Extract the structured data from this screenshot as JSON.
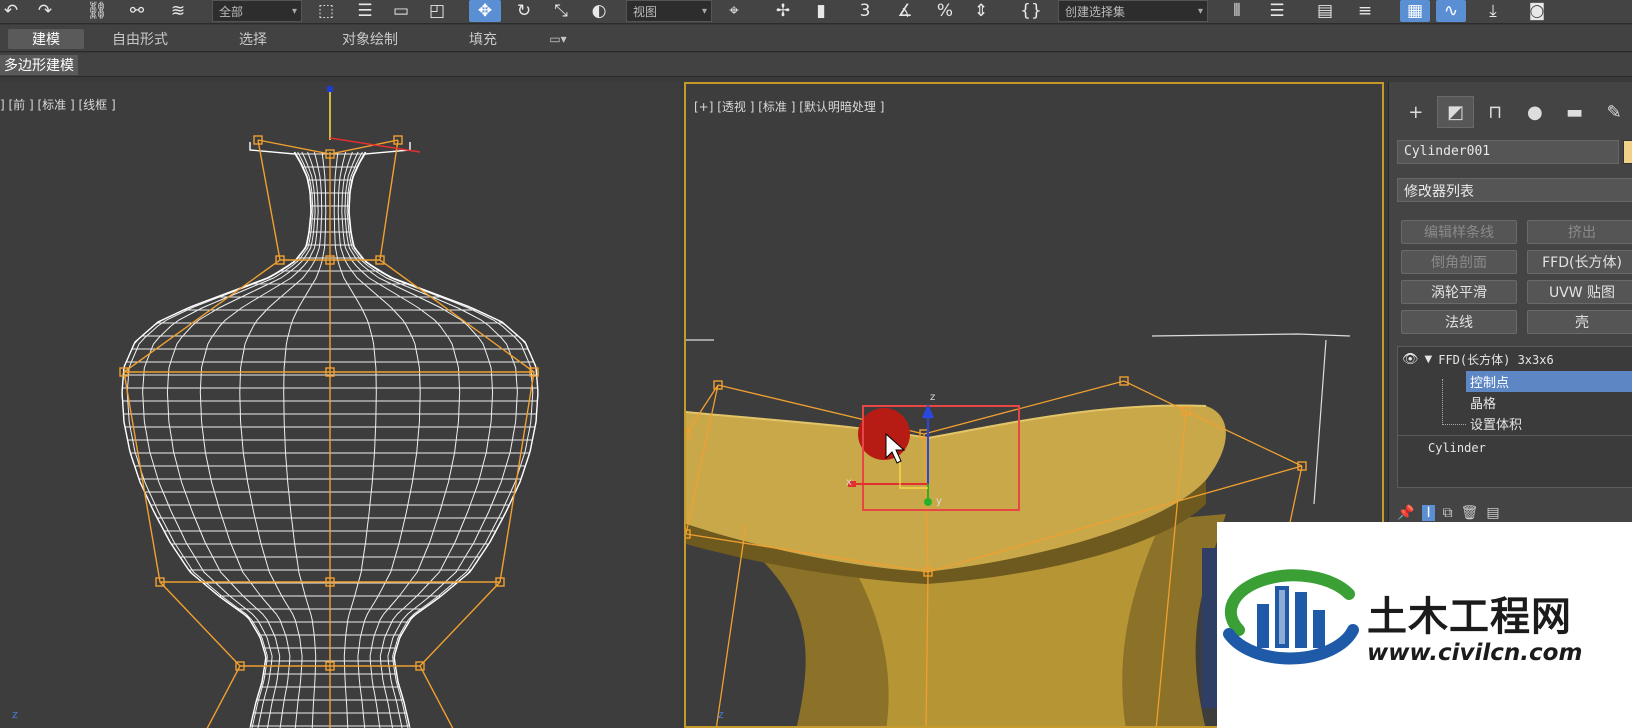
{
  "toolbar": {
    "selection_filter": "全部",
    "ref_coord": "视图",
    "named_selection_placeholder": "创建选择集",
    "snap_label": "3"
  },
  "ribbon": {
    "tabs": [
      "建模",
      "自由形式",
      "选择",
      "对象绘制",
      "填充"
    ],
    "active_tab": "建模",
    "sub_label": "多边形建模"
  },
  "viewport_front": {
    "label": "] [前 ] [标准 ] [线框 ]",
    "axis": "z"
  },
  "viewport_persp": {
    "label": "[+] [透视 ] [标准 ] [默认明暗处理 ]",
    "axis_z": "z",
    "axis_x": "x",
    "axis_y": "y",
    "corner_axis": "z"
  },
  "command_panel": {
    "object_name": "Cylinder001",
    "modifier_list": "修改器列表",
    "buttons": [
      {
        "label": "编辑样条线",
        "enabled": false
      },
      {
        "label": "挤出",
        "enabled": false
      },
      {
        "label": "倒角剖面",
        "enabled": false
      },
      {
        "label": "FFD(长方体)",
        "enabled": true
      },
      {
        "label": "涡轮平滑",
        "enabled": true
      },
      {
        "label": "UVW 贴图",
        "enabled": true
      },
      {
        "label": "法线",
        "enabled": true
      },
      {
        "label": "壳",
        "enabled": true
      }
    ],
    "stack": {
      "modifier": "FFD(长方体) 3x3x6",
      "sub_items": [
        "控制点",
        "晶格",
        "设置体积"
      ],
      "selected_sub": "控制点",
      "base_object": "Cylinder"
    }
  },
  "watermark": {
    "title": "土木工程网",
    "url": "www.civilcn.com"
  },
  "colors": {
    "background": "#3d3d3d",
    "lattice": "#f0a030",
    "wire": "#ffffff",
    "highlight": "#5c86c4",
    "vase_fill": "#c9a84a",
    "selection_box": "#e84545",
    "watermark_blue": "#1e5aa8",
    "watermark_green": "#3aa035"
  }
}
